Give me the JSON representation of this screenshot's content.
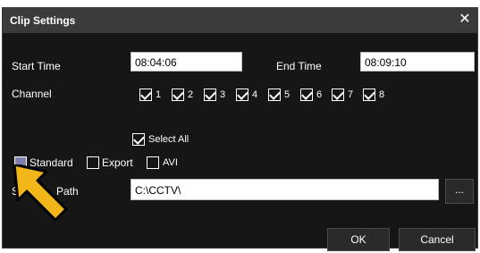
{
  "dialog": {
    "title": "Clip Settings",
    "close_glyph": "✕"
  },
  "time": {
    "start_label": "Start Time",
    "start_value": "08:04:06",
    "end_label": "End Time",
    "end_value": "08:09:10"
  },
  "channel": {
    "label": "Channel",
    "items": [
      "1",
      "2",
      "3",
      "4",
      "5",
      "6",
      "7",
      "8"
    ],
    "select_all_label": "Select All"
  },
  "format": {
    "standard": "Standard",
    "export": "Export",
    "avi": "AVI"
  },
  "storage": {
    "label_visible_left": "St",
    "label_visible_right": "Path",
    "path_value": "C:\\CCTV\\",
    "browse_label": "..."
  },
  "buttons": {
    "ok": "OK",
    "cancel": "Cancel"
  },
  "colors": {
    "dialog_bg": "#161616",
    "titlebar": "#3b3b3b",
    "arrow": "#f2b51a",
    "radio_selected": "#7f7fb0"
  },
  "icons": [
    "close-icon",
    "check-icon",
    "pointer-arrow-icon"
  ]
}
